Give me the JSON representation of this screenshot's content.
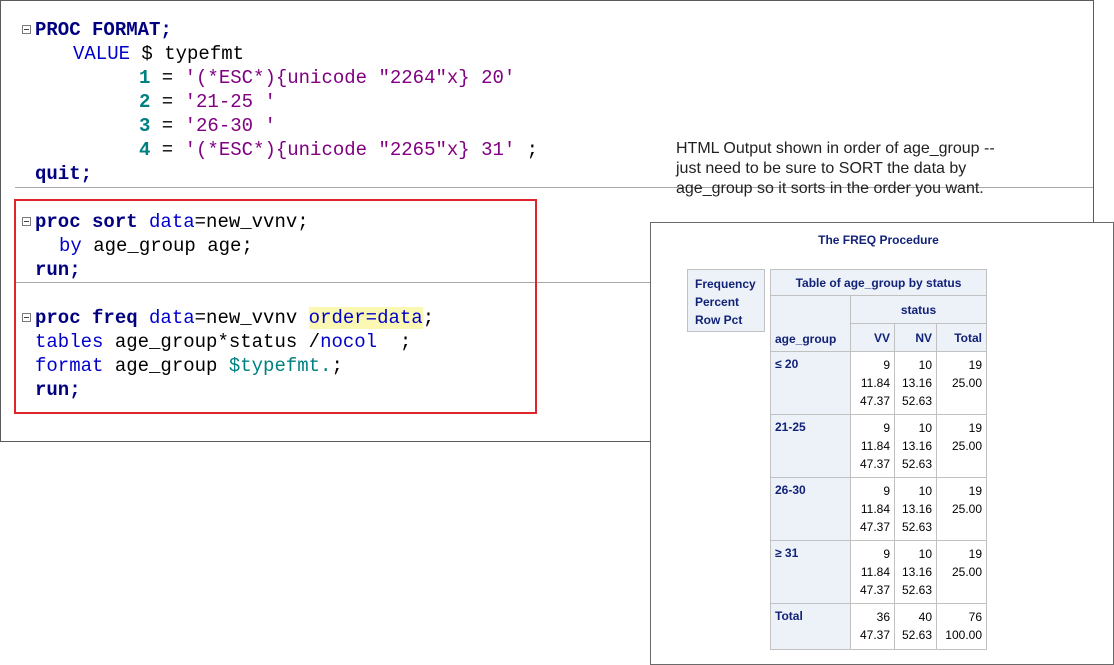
{
  "code": {
    "lines": [
      [
        "PROC FORMAT;"
      ],
      [
        "VALUE",
        " $ typefmt"
      ],
      [
        "1",
        " = ",
        "'(*ESC*){unicode \"2264\"x} 20'"
      ],
      [
        "2",
        " = ",
        "'21-25 '"
      ],
      [
        "3",
        " = ",
        "'26-30 '"
      ],
      [
        "4",
        " = ",
        "'(*ESC*){unicode \"2265\"x} 31'",
        " ;"
      ],
      [
        "quit;"
      ],
      [
        "proc sort",
        " data",
        "=new_vvnv;"
      ],
      [
        "by",
        " age_group age;"
      ],
      [
        "run;"
      ],
      [
        "proc freq",
        " data",
        "=new_vvnv ",
        "order=data",
        ";"
      ],
      [
        "tables",
        " age_group*status /",
        "nocol",
        "  ;"
      ],
      [
        "format",
        " age_group ",
        "$typefmt.",
        ";"
      ],
      [
        "run;"
      ]
    ]
  },
  "annotation": {
    "lines": [
      "HTML Output shown in order of age_group --",
      "just need to be sure to SORT the data by",
      "age_group so it sorts in the order you want."
    ]
  },
  "output": {
    "proc_title": "The FREQ Procedure",
    "legend": [
      "Frequency",
      "Percent",
      "Row Pct"
    ],
    "table_title": "Table of age_group by status",
    "col_var": "status",
    "row_var": "age_group",
    "columns": [
      "VV",
      "NV",
      "Total"
    ],
    "rows": [
      {
        "label": "≤ 20",
        "cells": [
          [
            "9",
            "11.84",
            "47.37"
          ],
          [
            "10",
            "13.16",
            "52.63"
          ],
          [
            "19",
            "25.00"
          ]
        ]
      },
      {
        "label": "21-25",
        "cells": [
          [
            "9",
            "11.84",
            "47.37"
          ],
          [
            "10",
            "13.16",
            "52.63"
          ],
          [
            "19",
            "25.00"
          ]
        ]
      },
      {
        "label": "26-30",
        "cells": [
          [
            "9",
            "11.84",
            "47.37"
          ],
          [
            "10",
            "13.16",
            "52.63"
          ],
          [
            "19",
            "25.00"
          ]
        ]
      },
      {
        "label": "≥ 31",
        "cells": [
          [
            "9",
            "11.84",
            "47.37"
          ],
          [
            "10",
            "13.16",
            "52.63"
          ],
          [
            "19",
            "25.00"
          ]
        ]
      }
    ],
    "total": {
      "label": "Total",
      "cells": [
        [
          "36",
          "47.37"
        ],
        [
          "40",
          "52.63"
        ],
        [
          "76",
          "100.00"
        ]
      ]
    }
  },
  "colors": {
    "highlight_box": "#e0242b",
    "header_text": "#112277",
    "header_bg": "#edf2f9"
  }
}
